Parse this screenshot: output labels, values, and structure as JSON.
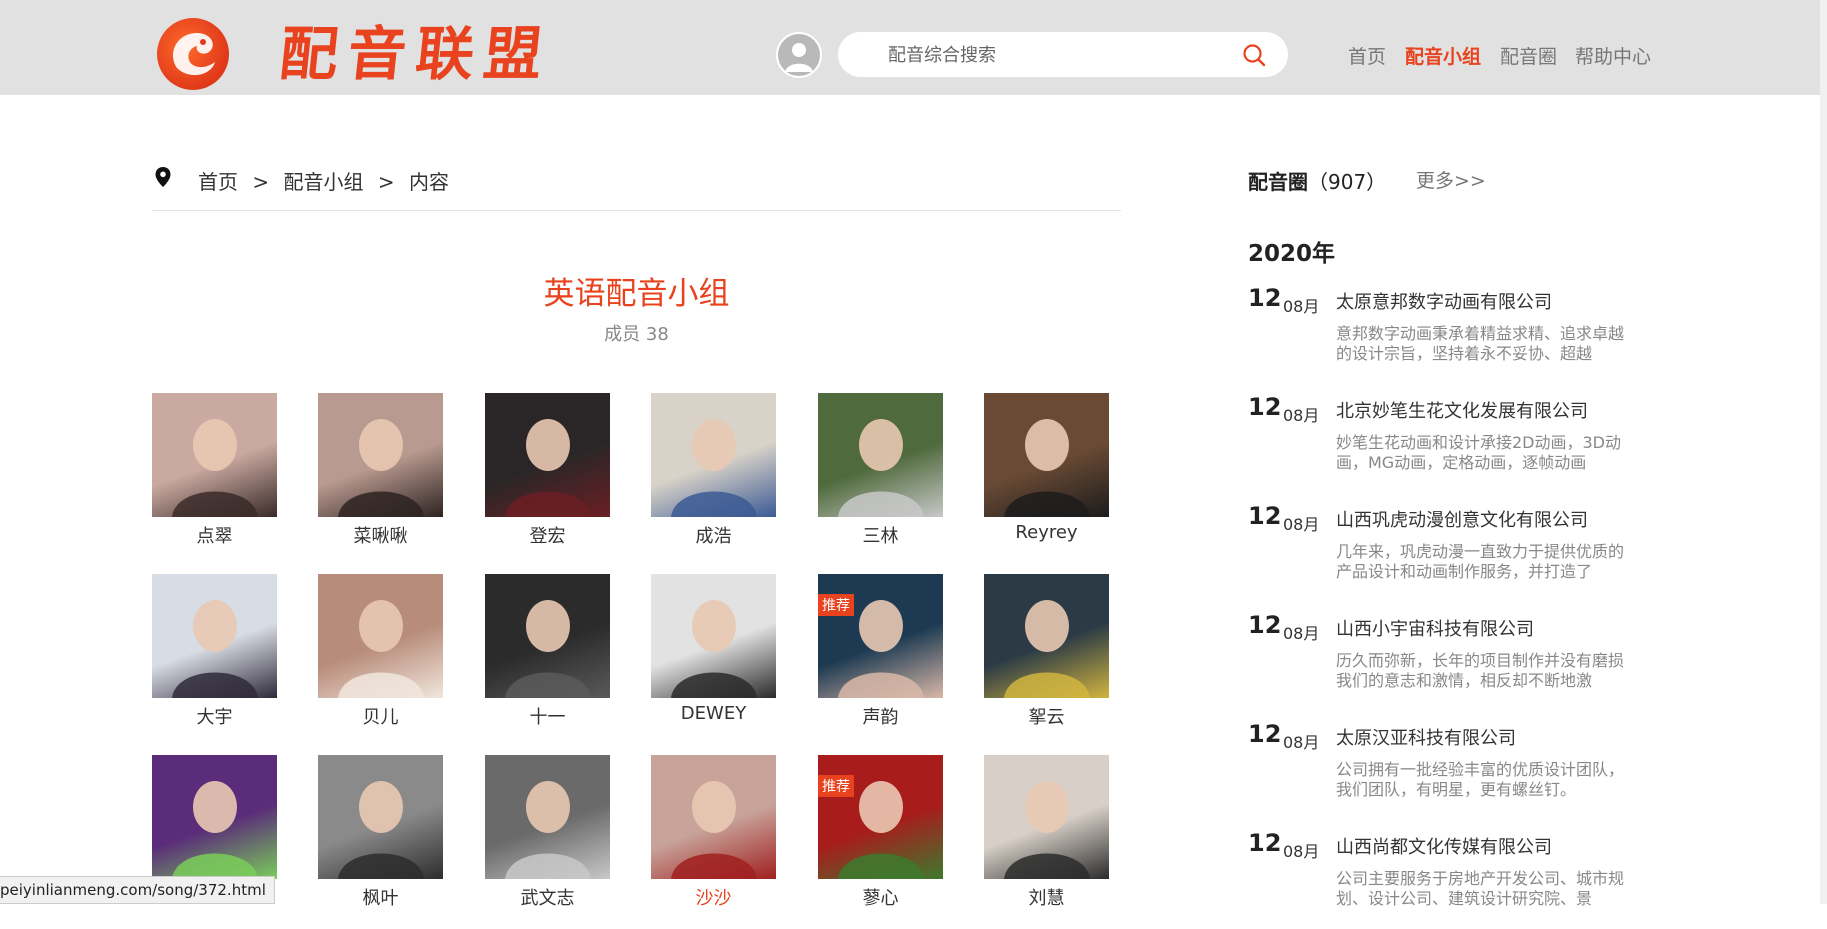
{
  "header": {
    "logo_text": "配音联盟",
    "search_placeholder": "配音综合搜索",
    "nav": [
      "首页",
      "配音小组",
      "配音圈",
      "帮助中心"
    ],
    "active_nav": "配音小组"
  },
  "breadcrumb": [
    "首页",
    ">",
    "配音小组",
    ">",
    "内容"
  ],
  "group": {
    "title": "英语配音小组",
    "members": "成员 38"
  },
  "cards": [
    {
      "name": "点翠"
    },
    {
      "name": "菜啾啾"
    },
    {
      "name": "登宏"
    },
    {
      "name": "成浩"
    },
    {
      "name": "三林"
    },
    {
      "name": "Reyrey"
    },
    {
      "name": "大宇"
    },
    {
      "name": "贝儿"
    },
    {
      "name": "十一"
    },
    {
      "name": "DEWEY"
    },
    {
      "name": "声韵",
      "badge": "推荐"
    },
    {
      "name": "挐云"
    },
    {
      "name": ""
    },
    {
      "name": "枫叶"
    },
    {
      "name": "武文志"
    },
    {
      "name": "沙沙"
    },
    {
      "name": "蓼心",
      "badge": "推荐"
    },
    {
      "name": "刘慧"
    }
  ],
  "sidebar": {
    "title": "配音圈",
    "count": "（907）",
    "more": "更多>>",
    "year": "2020年",
    "items": [
      {
        "day": "12",
        "month": "08月",
        "company": "太原意邦数字动画有限公司",
        "desc": "意邦数字动画秉承着精益求精、追求卓越的设计宗旨，坚持着永不妥协、超越"
      },
      {
        "day": "12",
        "month": "08月",
        "company": "北京妙笔生花文化发展有限公司",
        "desc": "妙笔生花动画和设计承接2D动画，3D动画，MG动画，定格动画，逐帧动画"
      },
      {
        "day": "12",
        "month": "08月",
        "company": "山西巩虎动漫创意文化有限公司",
        "desc": "几年来，巩虎动漫一直致力于提供优质的产品设计和动画制作服务，并打造了"
      },
      {
        "day": "12",
        "month": "08月",
        "company": "山西小宇宙科技有限公司",
        "desc": "历久而弥新，长年的项目制作并没有磨损我们的意志和激情，相反却不断地激"
      },
      {
        "day": "12",
        "month": "08月",
        "company": "太原汉亚科技有限公司",
        "desc": "公司拥有一批经验丰富的优质设计团队，我们团队，有明星，更有螺丝钉。"
      },
      {
        "day": "12",
        "month": "08月",
        "company": "山西尚都文化传媒有限公司",
        "desc": "公司主要服务于房地产开发公司、城市规划、设计公司、建筑设计研究院、景"
      }
    ]
  },
  "status_url": "peiyinlianmeng.com/song/372.html",
  "colors": {
    "accent": "#e8431e",
    "header_bg": "#e1e1e1"
  }
}
